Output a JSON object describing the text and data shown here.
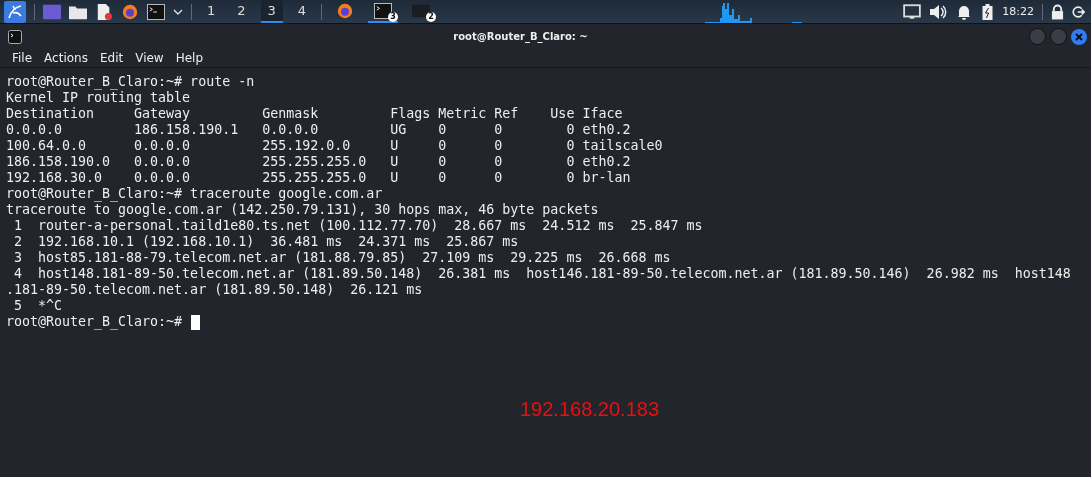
{
  "taskbar": {
    "workspaces": [
      {
        "label": "1",
        "selected": false
      },
      {
        "label": "2",
        "selected": false
      },
      {
        "label": "3",
        "selected": true
      },
      {
        "label": "4",
        "selected": false
      }
    ],
    "tasks": [
      {
        "kind": "browser",
        "selected": false
      },
      {
        "kind": "terminal",
        "badge": "3",
        "selected": true
      },
      {
        "kind": "window",
        "badge": "2",
        "selected": false
      }
    ],
    "clock": "18:22"
  },
  "window": {
    "title": "root@Router_B_Claro: ~"
  },
  "menu": [
    "File",
    "Actions",
    "Edit",
    "View",
    "Help"
  ],
  "terminal": {
    "lines": [
      "root@Router_B_Claro:~# route -n",
      "Kernel IP routing table",
      "Destination     Gateway         Genmask         Flags Metric Ref    Use Iface",
      "0.0.0.0         186.158.190.1   0.0.0.0         UG    0      0        0 eth0.2",
      "100.64.0.0      0.0.0.0         255.192.0.0     U     0      0        0 tailscale0",
      "186.158.190.0   0.0.0.0         255.255.255.0   U     0      0        0 eth0.2",
      "192.168.30.0    0.0.0.0         255.255.255.0   U     0      0        0 br-lan",
      "root@Router_B_Claro:~# traceroute google.com.ar",
      "traceroute to google.com.ar (142.250.79.131), 30 hops max, 46 byte packets",
      " 1  router-a-personal.taild1e80.ts.net (100.112.77.70)  28.667 ms  24.512 ms  25.847 ms",
      " 2  192.168.10.1 (192.168.10.1)  36.481 ms  24.371 ms  25.867 ms",
      " 3  host85.181-88-79.telecom.net.ar (181.88.79.85)  27.109 ms  29.225 ms  26.668 ms",
      " 4  host148.181-89-50.telecom.net.ar (181.89.50.148)  26.381 ms  host146.181-89-50.telecom.net.ar (181.89.50.146)  26.982 ms  host148",
      ".181-89-50.telecom.net.ar (181.89.50.148)  26.121 ms",
      " 5  *^C"
    ],
    "prompt": "root@Router_B_Claro:~#"
  },
  "annotation": "192.168.20.183"
}
